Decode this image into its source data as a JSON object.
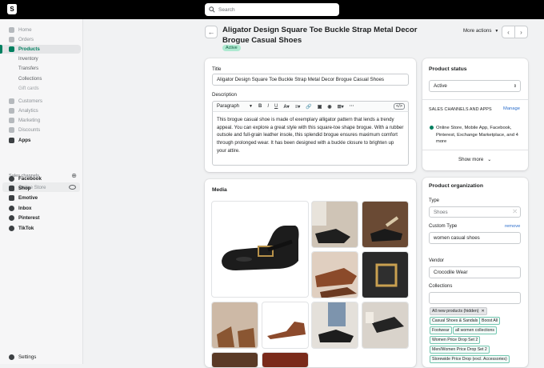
{
  "search": {
    "placeholder": "Search"
  },
  "sidebar": {
    "main": [
      {
        "label": "Home"
      },
      {
        "label": "Orders"
      },
      {
        "label": "Products"
      }
    ],
    "product_sub": [
      {
        "label": "Inventory"
      },
      {
        "label": "Transfers"
      },
      {
        "label": "Collections"
      },
      {
        "label": "Gift cards"
      }
    ],
    "more": [
      {
        "label": "Customers"
      },
      {
        "label": "Analytics"
      },
      {
        "label": "Marketing"
      },
      {
        "label": "Discounts"
      },
      {
        "label": "Apps"
      }
    ],
    "channels_heading": "Sales channels",
    "channels": [
      {
        "label": "Online Store"
      },
      {
        "label": "Facebook"
      },
      {
        "label": "Shop"
      },
      {
        "label": "Emotive"
      },
      {
        "label": "Inbox"
      },
      {
        "label": "Pinterest"
      },
      {
        "label": "TikTok"
      }
    ],
    "settings": "Settings"
  },
  "header": {
    "title": "Aligator Design Square Toe Buckle Strap Metal Decor Brogue Casual Shoes",
    "status_badge": "Active",
    "more_actions": "More actions"
  },
  "product": {
    "title_label": "Title",
    "title_value": "Aligator Design Square Toe Buckle Strap Metal Decor Brogue Casual Shoes",
    "description_label": "Description",
    "format_select": "Paragraph",
    "description": "This brogue casual shoe is made of exemplary alligator pattern that lends a trendy appeal. You can explore a great style with this square-toe shape brogue. With a rubber outsole and full-grain leather insole, this splendid brogue ensures maximum comfort through prolonged wear. It has been designed with a buckle closure to brighten up your attire."
  },
  "media": {
    "heading": "Media"
  },
  "status_card": {
    "heading": "Product status",
    "status_value": "Active",
    "channels_heading": "SALES CHANNELS AND APPS",
    "manage": "Manage",
    "channels_text": "Online Store, Mobile App, Facebook, Pinterest, Exchange Marketplace, and 4 more",
    "show_more": "Show more"
  },
  "organization": {
    "heading": "Product organization",
    "type_label": "Type",
    "type_value": "Shoes",
    "custom_type_label": "Custom Type",
    "remove": "remove",
    "custom_type_value": "women casual shoes",
    "vendor_label": "Vendor",
    "vendor_value": "Crocodile Wear",
    "collections_label": "Collections",
    "collections": [
      "All new products (hidden)",
      "Casual Shoes & Sandals",
      "Boost All",
      "Footwear",
      "all women collections",
      "Women Price Drop Set 2",
      "Men/Women Price Drop Set 2",
      "Storewide Price Drop (excl. Accessories)"
    ]
  },
  "colors": {
    "accent": "#008060",
    "link": "#2c6ecb",
    "badge": "#aee9d1"
  }
}
